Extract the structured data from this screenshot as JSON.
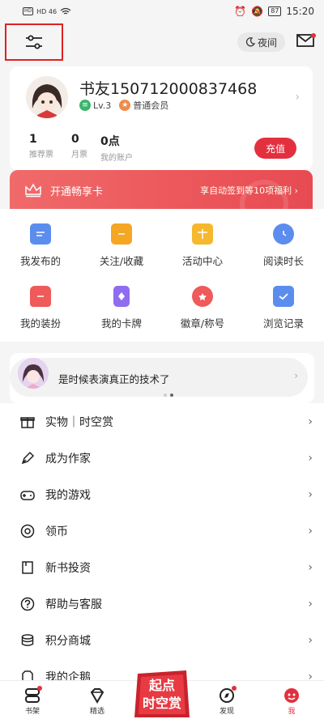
{
  "status_bar": {
    "signal_left": "HD 46",
    "signal_left2": "HD 46",
    "battery": "87",
    "time": "15:20"
  },
  "top_bar": {
    "night_label": "夜间",
    "icons": [
      "settings-sliders-icon",
      "moon-icon",
      "mail-icon"
    ]
  },
  "profile": {
    "username": "书友150712000837468",
    "level": "Lv.3",
    "member": "普通会员",
    "stats": [
      {
        "value": "1",
        "label": "推荐票"
      },
      {
        "value": "0",
        "label": "月票"
      },
      {
        "value": "0点",
        "label": "我的账户"
      }
    ],
    "recharge_label": "充值"
  },
  "vip": {
    "title": "开通畅享卡",
    "desc": "享自动签到等10项福利"
  },
  "grid": [
    {
      "label": "我发布的",
      "icon": "chat-icon",
      "color": "#5b8def"
    },
    {
      "label": "关注/收藏",
      "icon": "folder-icon",
      "color": "#f5a623"
    },
    {
      "label": "活动中心",
      "icon": "gift-box-icon",
      "color": "#f5b82e"
    },
    {
      "label": "阅读时长",
      "icon": "clock-icon",
      "color": "#5b8def"
    },
    {
      "label": "我的装扮",
      "icon": "shirt-icon",
      "color": "#ef5a5a"
    },
    {
      "label": "我的卡牌",
      "icon": "card-icon",
      "color": "#8f6cf0"
    },
    {
      "label": "徽章/称号",
      "icon": "medal-icon",
      "color": "#ef5a5a"
    },
    {
      "label": "浏览记录",
      "icon": "history-icon",
      "color": "#5b8def"
    }
  ],
  "recommend": {
    "text": "是时候表演真正的技术了"
  },
  "menu": [
    {
      "label": "实物｜时空赏",
      "icon": "gift-icon"
    },
    {
      "label": "成为作家",
      "icon": "pen-icon"
    },
    {
      "label": "我的游戏",
      "icon": "gamepad-icon"
    },
    {
      "label": "领币",
      "icon": "coin-icon"
    },
    {
      "label": "新书投资",
      "icon": "book-invest-icon"
    },
    {
      "label": "帮助与客服",
      "icon": "help-icon"
    },
    {
      "label": "积分商城",
      "icon": "points-mall-icon"
    },
    {
      "label": "我的企鹅",
      "icon": "penguin-icon"
    }
  ],
  "bottom_nav": [
    {
      "label": "书架",
      "icon": "bookshelf-icon"
    },
    {
      "label": "精选",
      "icon": "diamond-icon"
    },
    {
      "label": "",
      "icon": "promo-icon"
    },
    {
      "label": "发现",
      "icon": "compass-icon"
    },
    {
      "label": "我",
      "icon": "me-icon"
    }
  ],
  "promo": {
    "line1": "起点",
    "line2": "时空赏"
  },
  "colors": {
    "accent": "#e3303e",
    "background": "#f5f5f5"
  }
}
